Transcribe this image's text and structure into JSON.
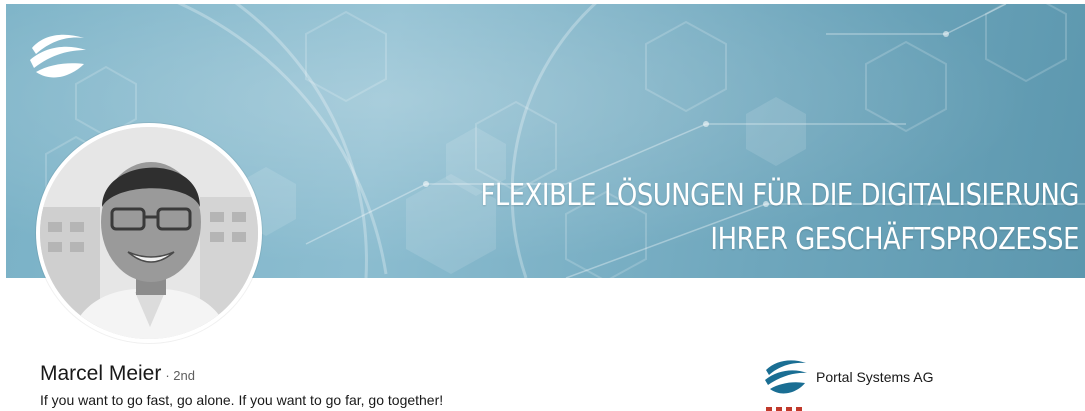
{
  "banner": {
    "headline_line1": "FLEXIBLE LÖSUNGEN FÜR DIE DIGITALISIERUNG",
    "headline_line2": "IHRER GESCHÄFTSPROZESSE",
    "logo_icon": "portal-wave-logo-icon"
  },
  "profile": {
    "name": "Marcel Meier",
    "degree": "· 2nd",
    "tagline": "If you want to go fast, go alone. If you want to go far, go together!",
    "avatar_icon": "profile-photo"
  },
  "company": {
    "name": "Portal Systems AG",
    "logo_icon": "portal-wave-logo-icon"
  },
  "colors": {
    "banner_base": "#79b1c6",
    "logo_blue": "#1a6e93",
    "text_primary": "#191919",
    "text_secondary": "#5e5e5e",
    "accent_red": "#c0392b"
  }
}
